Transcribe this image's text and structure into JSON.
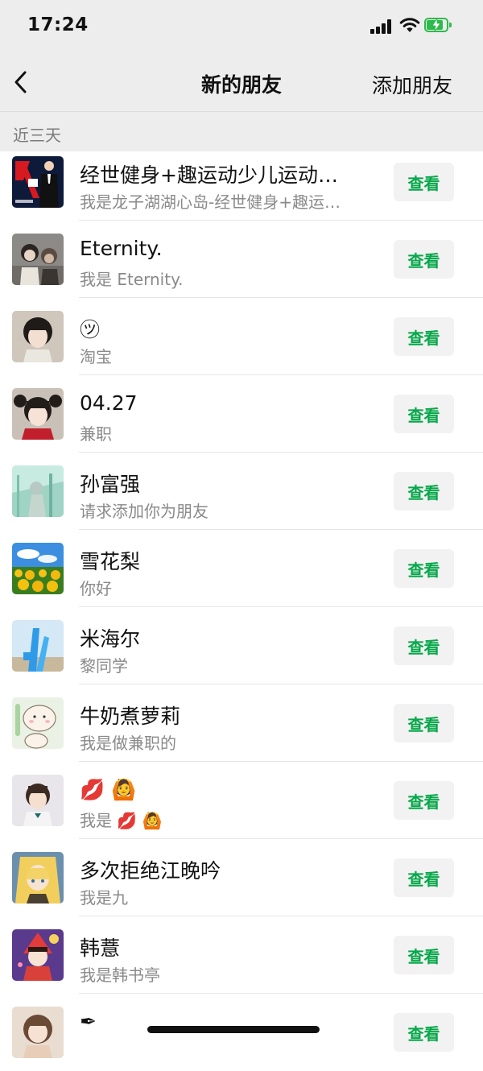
{
  "status": {
    "time": "17:24"
  },
  "nav": {
    "title": "新的朋友",
    "action": "添加朋友"
  },
  "section": {
    "label": "近三天"
  },
  "button_label": "查看",
  "requests": [
    {
      "name": "经世健身+趣运动少儿运动…",
      "message": "我是龙子湖湖心岛-经世健身+趣运…"
    },
    {
      "name": "Eternity.",
      "message": "我是 Eternity."
    },
    {
      "name": "㋡",
      "message": "淘宝"
    },
    {
      "name": "04.27",
      "message": "兼职"
    },
    {
      "name": "孙富强",
      "message": "请求添加你为朋友"
    },
    {
      "name": "雪花梨",
      "message": "你好"
    },
    {
      "name": "米海尔",
      "message": "黎同学"
    },
    {
      "name": "牛奶煮萝莉",
      "message": "我是做兼职的"
    },
    {
      "name": "💋 🙆",
      "message": "我是 💋 🙆"
    },
    {
      "name": "多次拒绝江晚吟",
      "message": "我是九"
    },
    {
      "name": "韩薏",
      "message": "我是韩书亭"
    },
    {
      "name": "✒",
      "message": ""
    }
  ],
  "colors": {
    "accent_green": "#07a84a",
    "header_bg": "#ededed",
    "battery_green": "#30b94d"
  }
}
